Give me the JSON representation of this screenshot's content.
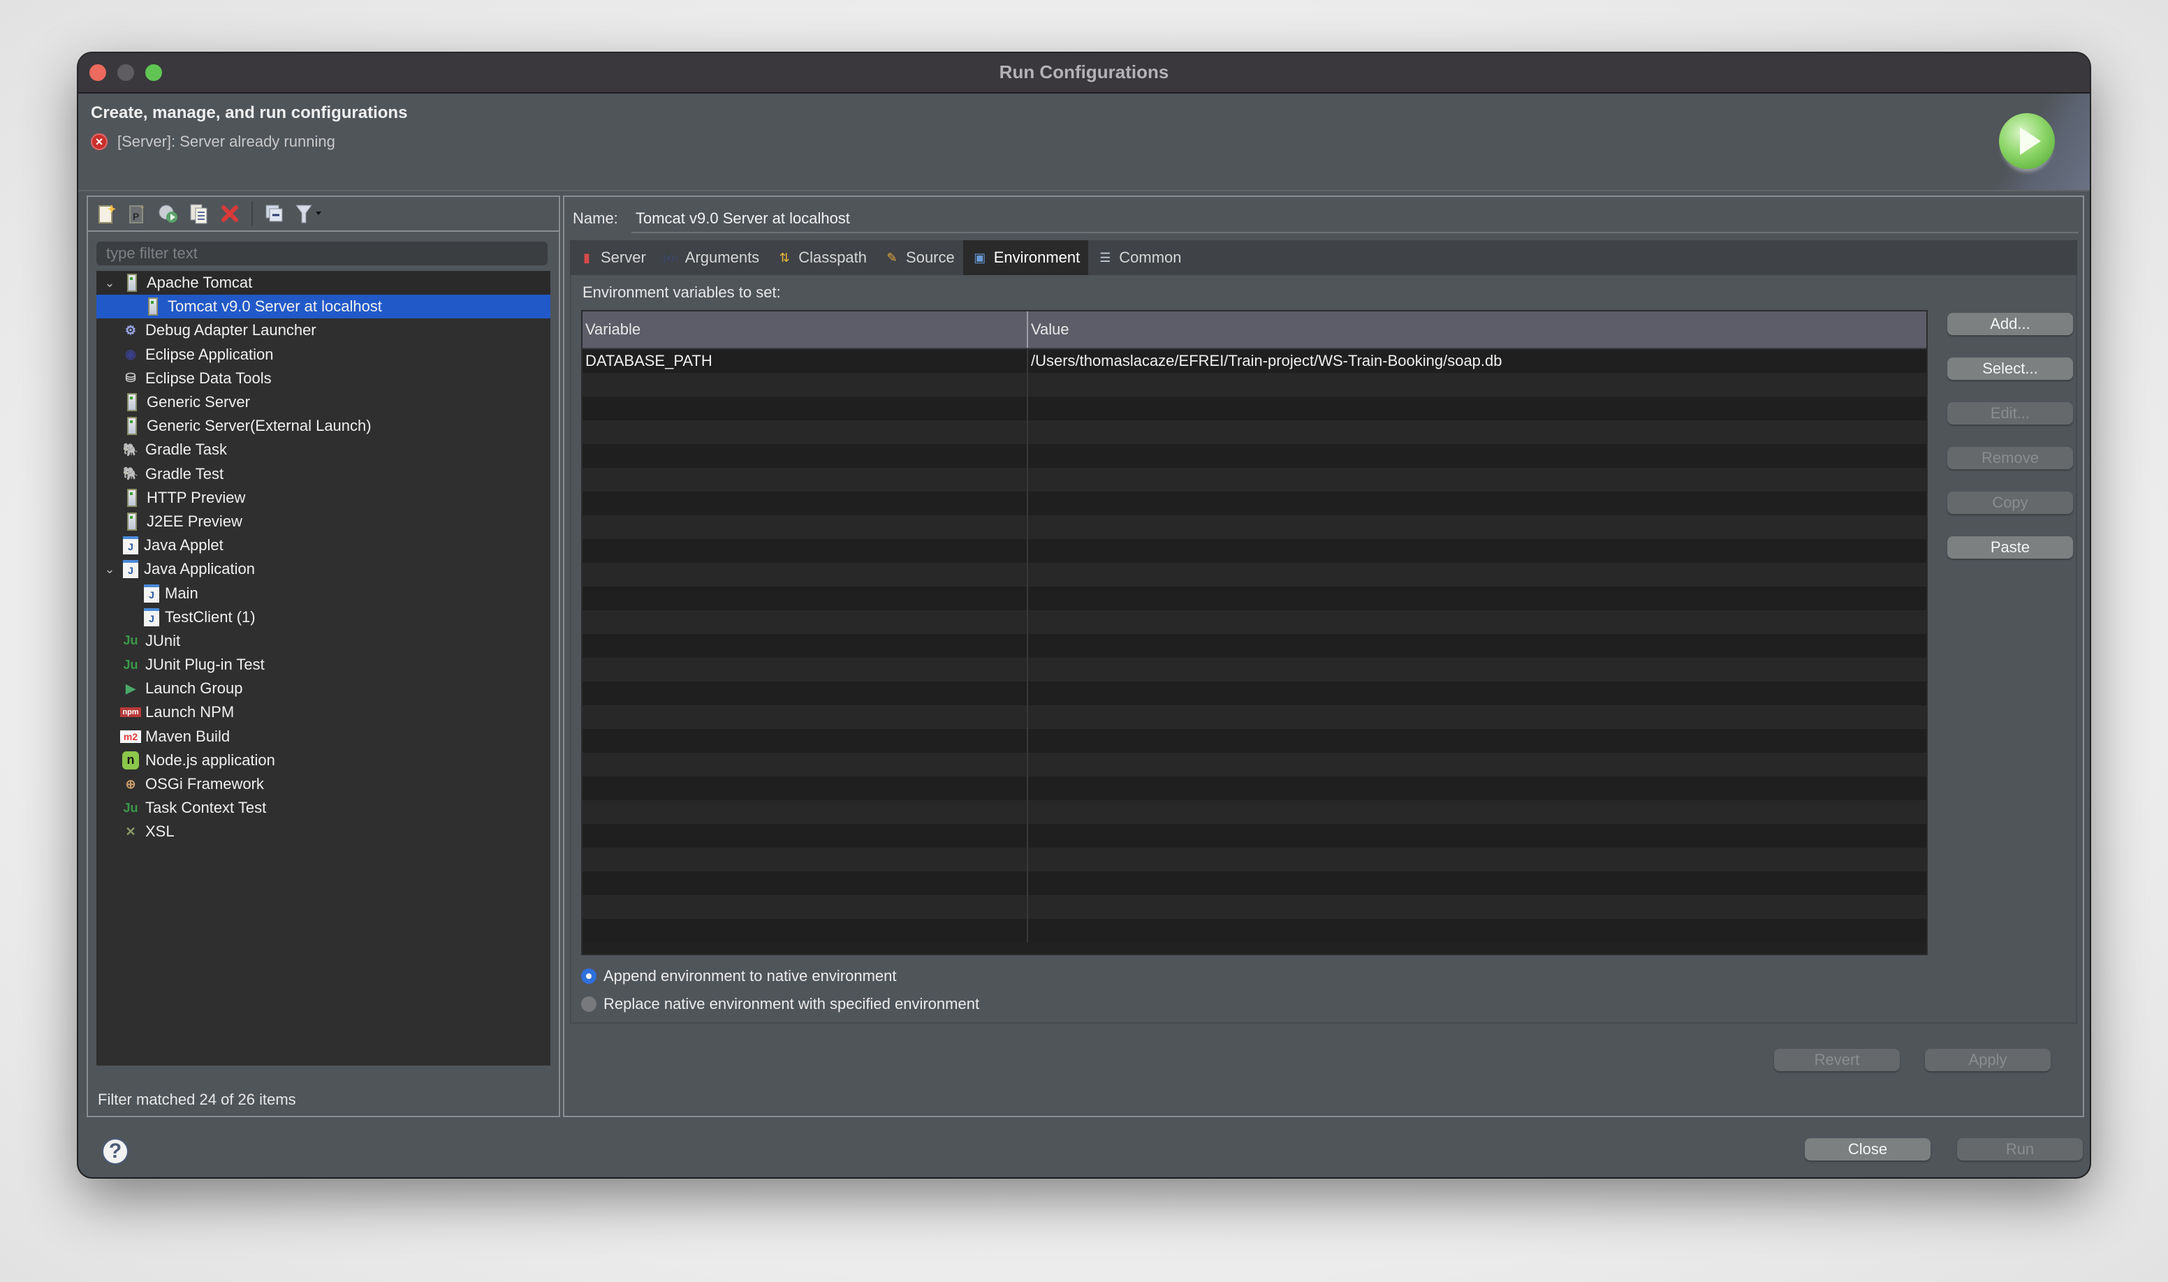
{
  "window": {
    "title": "Run Configurations"
  },
  "header": {
    "title": "Create, manage, and run configurations",
    "message": "[Server]: Server already running",
    "message_icon": "error-icon",
    "banner_icon": "run-icon"
  },
  "left_panel": {
    "toolbar": [
      {
        "name": "new-configuration",
        "icon": "new-document-icon",
        "glyph": "📄"
      },
      {
        "name": "new-prototype",
        "icon": "new-prototype-icon",
        "glyph": "P"
      },
      {
        "name": "export",
        "icon": "export-icon",
        "glyph": "⟳"
      },
      {
        "name": "duplicate",
        "icon": "duplicate-icon",
        "glyph": "❐"
      },
      {
        "name": "delete",
        "icon": "delete-icon",
        "glyph": "✖"
      },
      {
        "name": "collapse-all",
        "icon": "collapse-all-icon",
        "glyph": "⊟"
      },
      {
        "name": "filter",
        "icon": "filter-icon",
        "glyph": "▼"
      }
    ],
    "filter_placeholder": "type filter text",
    "filter_value": "",
    "tree": [
      {
        "label": "Apache Tomcat",
        "level": 0,
        "expanded": true,
        "icon": "server-icon"
      },
      {
        "label": "Tomcat v9.0 Server at localhost",
        "level": 1,
        "selected": true,
        "icon": "server-icon"
      },
      {
        "label": "Debug Adapter Launcher",
        "level": 0,
        "icon": "debug-adapter-icon"
      },
      {
        "label": "Eclipse Application",
        "level": 0,
        "icon": "eclipse-icon"
      },
      {
        "label": "Eclipse Data Tools",
        "level": 0,
        "icon": "database-icon"
      },
      {
        "label": "Generic Server",
        "level": 0,
        "icon": "server-icon"
      },
      {
        "label": "Generic Server(External Launch)",
        "level": 0,
        "icon": "server-icon"
      },
      {
        "label": "Gradle Task",
        "level": 0,
        "icon": "gradle-icon"
      },
      {
        "label": "Gradle Test",
        "level": 0,
        "icon": "gradle-icon"
      },
      {
        "label": "HTTP Preview",
        "level": 0,
        "icon": "server-icon"
      },
      {
        "label": "J2EE Preview",
        "level": 0,
        "icon": "server-icon"
      },
      {
        "label": "Java Applet",
        "level": 0,
        "icon": "java-applet-icon"
      },
      {
        "label": "Java Application",
        "level": 0,
        "expanded": true,
        "icon": "java-app-icon"
      },
      {
        "label": "Main",
        "level": 1,
        "icon": "java-app-icon"
      },
      {
        "label": "TestClient (1)",
        "level": 1,
        "icon": "java-app-icon"
      },
      {
        "label": "JUnit",
        "level": 0,
        "icon": "junit-icon"
      },
      {
        "label": "JUnit Plug-in Test",
        "level": 0,
        "icon": "junit-plugin-icon"
      },
      {
        "label": "Launch Group",
        "level": 0,
        "icon": "launch-group-icon"
      },
      {
        "label": "Launch NPM",
        "level": 0,
        "icon": "npm-icon"
      },
      {
        "label": "Maven Build",
        "level": 0,
        "icon": "maven-icon"
      },
      {
        "label": "Node.js application",
        "level": 0,
        "icon": "nodejs-icon"
      },
      {
        "label": "OSGi Framework",
        "level": 0,
        "icon": "osgi-icon"
      },
      {
        "label": "Task Context Test",
        "level": 0,
        "icon": "task-context-icon"
      },
      {
        "label": "XSL",
        "level": 0,
        "icon": "xsl-icon"
      }
    ],
    "filter_status": "Filter matched 24 of 26 items"
  },
  "right_panel": {
    "name_label": "Name:",
    "name_value": "Tomcat v9.0 Server at localhost",
    "tabs": [
      {
        "label": "Server",
        "icon": "server-tab-icon",
        "active": false
      },
      {
        "label": "Arguments",
        "icon": "arguments-icon",
        "active": false
      },
      {
        "label": "Classpath",
        "icon": "classpath-icon",
        "active": false
      },
      {
        "label": "Source",
        "icon": "source-icon",
        "active": false
      },
      {
        "label": "Environment",
        "icon": "environment-icon",
        "active": true
      },
      {
        "label": "Common",
        "icon": "common-icon",
        "active": false
      }
    ],
    "env_label": "Environment variables to set:",
    "table": {
      "columns": [
        "Variable",
        "Value"
      ],
      "rows": [
        {
          "variable": "DATABASE_PATH",
          "value": "/Users/thomaslacaze/EFREI/Train-project/WS-Train-Booking/soap.db"
        }
      ]
    },
    "side_buttons": [
      {
        "label": "Add...",
        "enabled": true
      },
      {
        "label": "Select...",
        "enabled": true
      },
      {
        "label": "Edit...",
        "enabled": false
      },
      {
        "label": "Remove",
        "enabled": false
      },
      {
        "label": "Copy",
        "enabled": false
      },
      {
        "label": "Paste",
        "enabled": true
      }
    ],
    "radios": [
      {
        "label": "Append environment to native environment",
        "checked": true
      },
      {
        "label": "Replace native environment with specified environment",
        "checked": false
      }
    ],
    "revert_label": "Revert",
    "apply_label": "Apply"
  },
  "footer": {
    "close_label": "Close",
    "run_label": "Run"
  },
  "colors": {
    "selection": "#2159c8",
    "radio_checked": "#2f6fdc",
    "error": "#c9302c"
  }
}
